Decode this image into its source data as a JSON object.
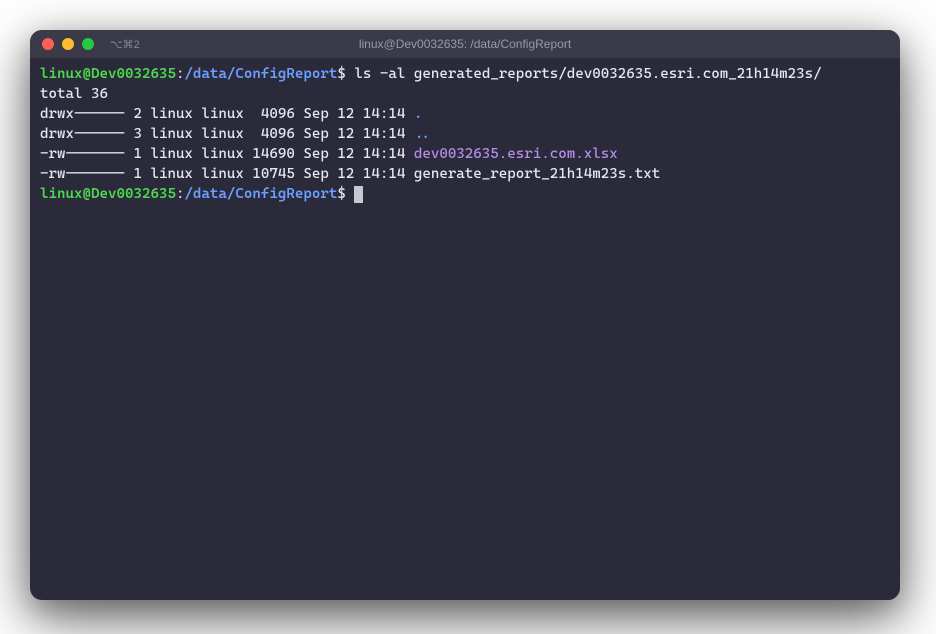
{
  "titlebar": {
    "tab_label": "⌥⌘2",
    "window_title": "linux@Dev0032635: /data/ConfigReport"
  },
  "prompt": {
    "user_host": "linux@Dev0032635",
    "separator": ":",
    "path": "/data/ConfigReport",
    "dollar": "$"
  },
  "command1": "ls -al generated_reports/dev0032635.esri.com_21h14m23s/",
  "output": {
    "total": "total 36",
    "rows": [
      {
        "perms": "drwx------",
        "links": "2",
        "owner": "linux",
        "group": "linux",
        "size": " 4096",
        "date": "Sep 12 14:14",
        "name": ".",
        "cls": "dir-link"
      },
      {
        "perms": "drwx------",
        "links": "3",
        "owner": "linux",
        "group": "linux",
        "size": " 4096",
        "date": "Sep 12 14:14",
        "name": "..",
        "cls": "dir-link"
      },
      {
        "perms": "-rw-------",
        "links": "1",
        "owner": "linux",
        "group": "linux",
        "size": "14690",
        "date": "Sep 12 14:14",
        "name": "dev0032635.esri.com.xlsx",
        "cls": "file-xlsx"
      },
      {
        "perms": "-rw-------",
        "links": "1",
        "owner": "linux",
        "group": "linux",
        "size": "10745",
        "date": "Sep 12 14:14",
        "name": "generate_report_21h14m23s.txt",
        "cls": ""
      }
    ]
  },
  "colors": {
    "bg": "#2a2a3a",
    "titlebar": "#3a3a48",
    "text": "#e8e8f0",
    "green": "#4dd84d",
    "blue": "#6a9eff",
    "purple": "#b58ee8"
  }
}
